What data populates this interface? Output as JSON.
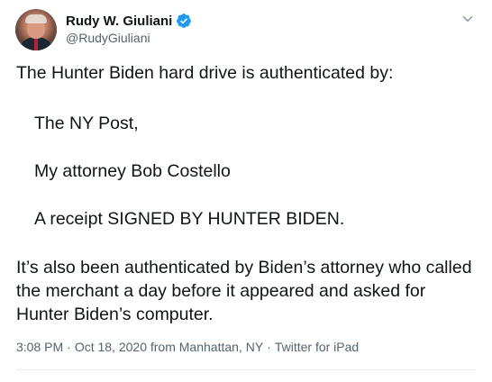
{
  "author": {
    "display_name": "Rudy W. Giuliani",
    "handle": "@RudyGiuliani",
    "verified": true,
    "verified_icon": "verified-badge-icon",
    "avatar": "profile-photo"
  },
  "menu_icon": "chevron-down-icon",
  "tweet": {
    "line1": "The Hunter Biden hard drive is authenticated by:",
    "item1": "The NY Post,",
    "item2": "My attorney Bob Costello",
    "item3": "A receipt SIGNED BY HUNTER BIDEN.",
    "paragraph2": "It’s also been authenticated by Biden’s attorney who called the merchant a day before it appeared and asked for Hunter Biden’s computer."
  },
  "meta": {
    "time": "3:08 PM",
    "date": "Oct 18, 2020",
    "location_prefix": "from",
    "location": "Manhattan, NY",
    "source": "Twitter for iPad",
    "separator": "·"
  },
  "colors": {
    "text": "#0f1419",
    "secondary": "#536471",
    "verified": "#1d9bf0",
    "divider": "#e6ecf0"
  }
}
